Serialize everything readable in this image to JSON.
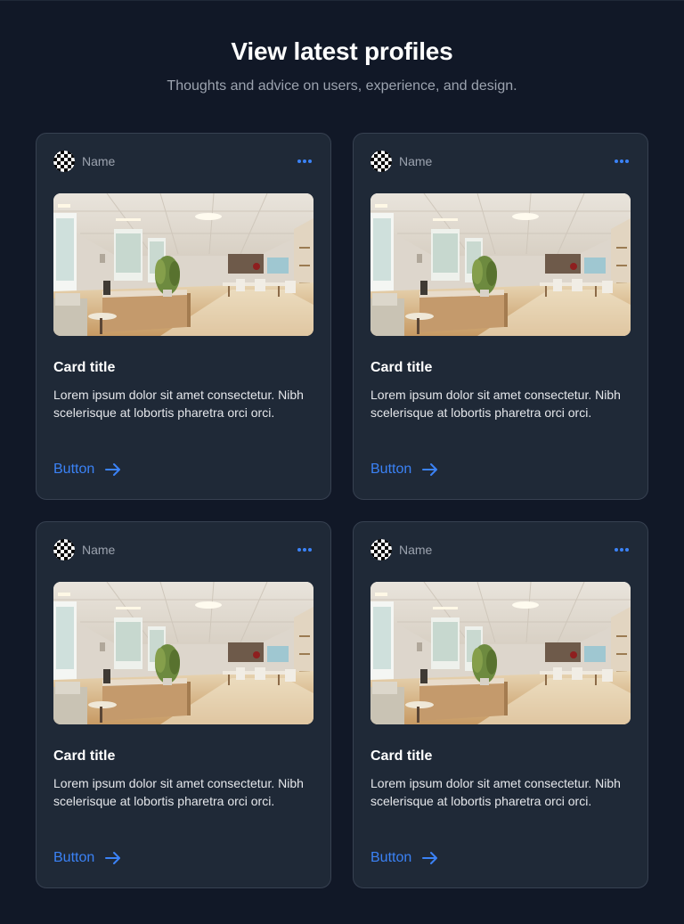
{
  "header": {
    "title": "View latest profiles",
    "subtitle": "Thoughts and advice on users, experience, and design."
  },
  "cards": [
    {
      "author": "Name",
      "title": "Card title",
      "body": "Lorem ipsum dolor sit amet consectetur. Nibh scelerisque at lobortis pharetra orci orci.",
      "button_label": "Button"
    },
    {
      "author": "Name",
      "title": "Card title",
      "body": "Lorem ipsum dolor sit amet consectetur. Nibh scelerisque at lobortis pharetra orci orci.",
      "button_label": "Button"
    },
    {
      "author": "Name",
      "title": "Card title",
      "body": "Lorem ipsum dolor sit amet consectetur. Nibh scelerisque at lobortis pharetra orci orci.",
      "button_label": "Button"
    },
    {
      "author": "Name",
      "title": "Card title",
      "body": "Lorem ipsum dolor sit amet consectetur. Nibh scelerisque at lobortis pharetra orci orci.",
      "button_label": "Button"
    }
  ],
  "icons": {
    "avatar": "checker-avatar-icon",
    "more": "more-horizontal-icon",
    "arrow": "arrow-right-icon"
  },
  "colors": {
    "background": "#111827",
    "card": "#1f2937",
    "card_border": "#374151",
    "accent": "#3b82f6",
    "muted_text": "#9ca3af"
  }
}
